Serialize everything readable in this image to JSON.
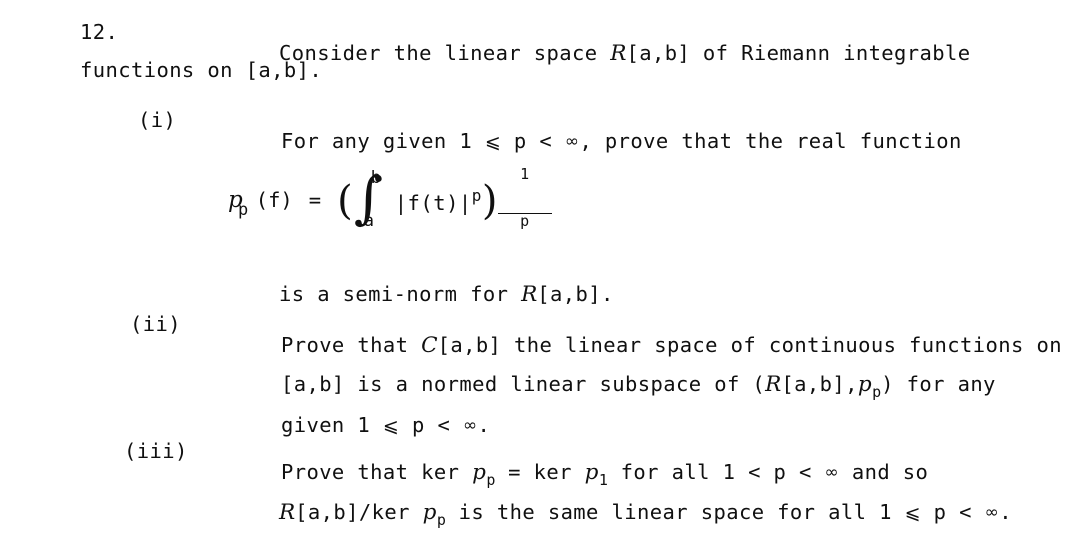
{
  "document": {
    "problem_number": "12.",
    "stem": {
      "line1_pre": "Consider the linear space ",
      "line1_sym": "R",
      "line1_post": "[a,b] of Riemann integrable",
      "line2": "functions on [a,b]."
    },
    "parts": [
      {
        "label": "(i)",
        "lines": [
          {
            "segments": [
              {
                "text": "For any given 1 "
              },
              {
                "text": "⩽",
                "style": "le"
              },
              {
                "text": " p < "
              },
              {
                "text": "∞",
                "style": "inf"
              },
              {
                "text": ", prove that the real function"
              }
            ]
          }
        ]
      },
      {
        "label": "",
        "lines": [
          {
            "segments": [
              {
                "text": "is a semi-norm for "
              },
              {
                "text": "R",
                "style": "cal"
              },
              {
                "text": "[a,b]."
              }
            ]
          }
        ]
      },
      {
        "label": "(ii)",
        "lines": [
          {
            "segments": [
              {
                "text": "Prove that "
              },
              {
                "text": "C",
                "style": "cal"
              },
              {
                "text": "[a,b] the linear space of continuous functions on"
              }
            ]
          },
          {
            "segments": [
              {
                "text": "[a,b] is a normed linear subspace of ("
              },
              {
                "text": "R",
                "style": "cal"
              },
              {
                "text": "[a,b],"
              },
              {
                "text": "p",
                "style": "sym"
              },
              {
                "text": "p",
                "style": "sub"
              },
              {
                "text": ") for any"
              }
            ]
          },
          {
            "segments": [
              {
                "text": "given 1 "
              },
              {
                "text": "⩽",
                "style": "le"
              },
              {
                "text": " p < "
              },
              {
                "text": "∞",
                "style": "inf"
              },
              {
                "text": "."
              }
            ]
          }
        ]
      },
      {
        "label": "(iii)",
        "lines": [
          {
            "segments": [
              {
                "text": "Prove that ker "
              },
              {
                "text": "p",
                "style": "sym"
              },
              {
                "text": "p",
                "style": "sub"
              },
              {
                "text": " = ker "
              },
              {
                "text": "p",
                "style": "sym"
              },
              {
                "text": "1",
                "style": "sub"
              },
              {
                "text": " for all 1 < p < "
              },
              {
                "text": "∞",
                "style": "inf"
              },
              {
                "text": " and so"
              }
            ]
          },
          {
            "segments": [
              {
                "text": "R",
                "style": "cal"
              },
              {
                "text": "[a,b]/ker "
              },
              {
                "text": "p",
                "style": "sym"
              },
              {
                "text": "p",
                "style": "sub"
              },
              {
                "text": " is the same linear space for all 1 "
              },
              {
                "text": "⩽",
                "style": "le"
              },
              {
                "text": " p < "
              },
              {
                "text": "∞",
                "style": "inf"
              },
              {
                "text": "."
              }
            ]
          }
        ]
      }
    ],
    "formula": {
      "symbol": "p",
      "symbol_subscript": "p",
      "argument": "(f)",
      "equals": "=",
      "open_paren": "(",
      "integral_glyph": "∫",
      "upper_limit": "b",
      "lower_limit": "a",
      "integrand": "|f(t)|",
      "integrand_power": "p",
      "close_paren": ")",
      "exponent_numerator": "1",
      "exponent_denominator": "p"
    }
  },
  "colors": {
    "background": "#ffffff",
    "text": "#101010"
  }
}
